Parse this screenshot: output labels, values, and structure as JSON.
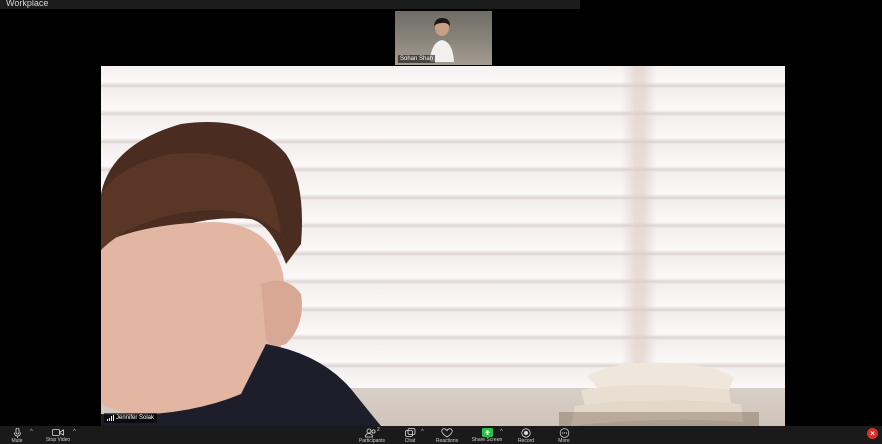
{
  "window": {
    "title": "Workplace"
  },
  "thumbnail": {
    "participant_name": "Sohan Shah"
  },
  "main_video": {
    "participant_name": "Jennifer Solak"
  },
  "toolbar": {
    "mute_label": "Mute",
    "stop_video_label": "Stop Video",
    "participants_label": "Participants",
    "participants_count": "2",
    "chat_label": "Chat",
    "reactions_label": "Reactions",
    "share_screen_label": "Share Screen",
    "record_label": "Record",
    "more_label": "More"
  },
  "colors": {
    "toolbar_bg": "#1a1a1a",
    "share_accent": "#2cbf4a",
    "end_button": "#d9302c"
  }
}
